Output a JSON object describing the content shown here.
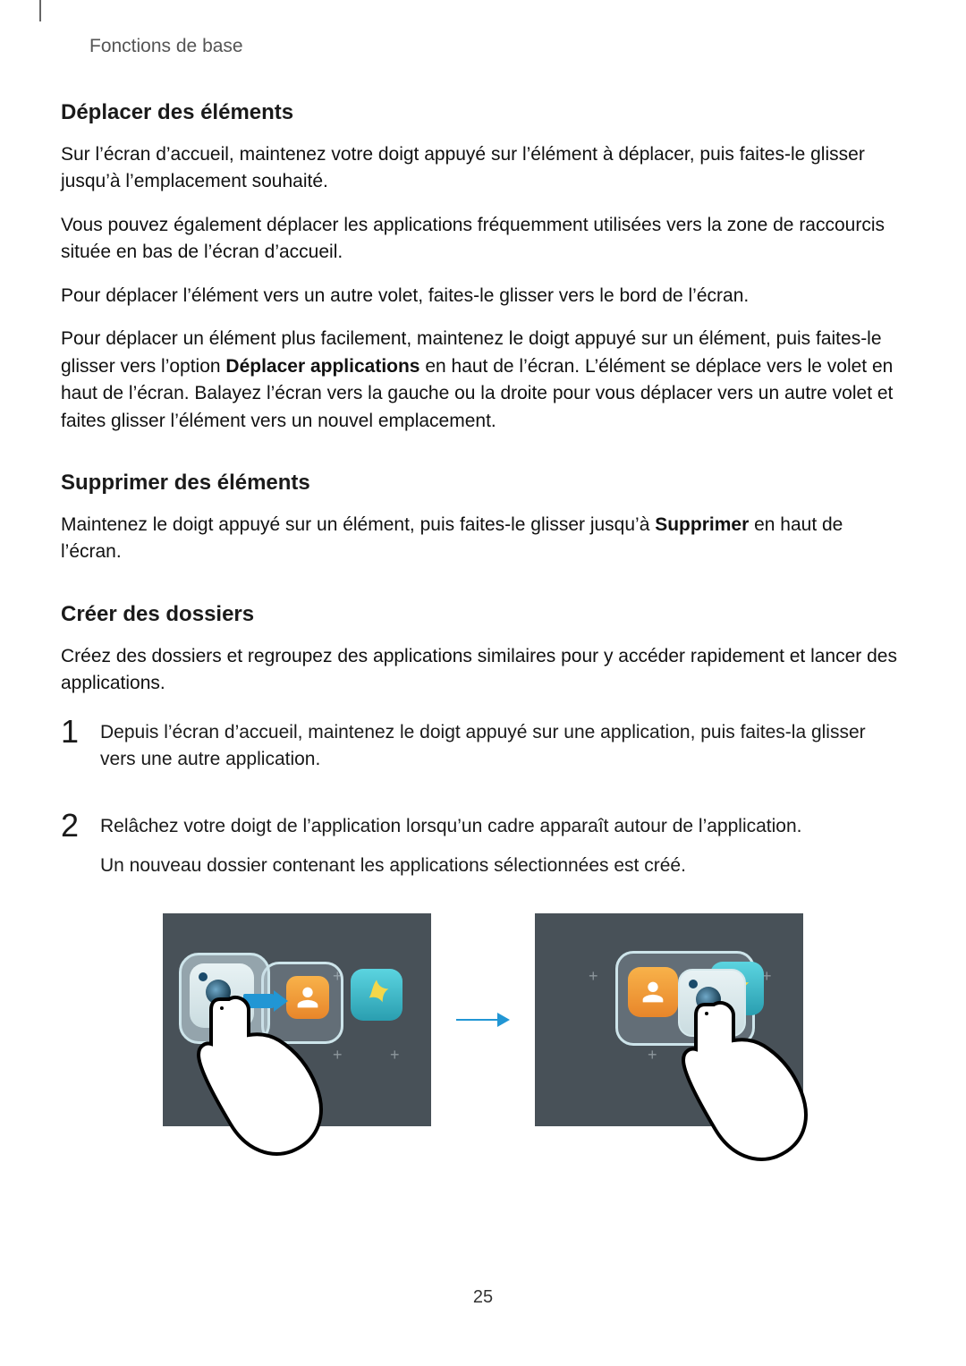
{
  "header": "Fonctions de base",
  "sections": {
    "move": {
      "heading": "Déplacer des éléments",
      "p1": "Sur l’écran d’accueil, maintenez votre doigt appuyé sur l’élément à déplacer, puis faites-le glisser jusqu’à l’emplacement souhaité.",
      "p2": "Vous pouvez également déplacer les applications fréquemment utilisées vers la zone de raccourcis située en bas de l’écran d’accueil.",
      "p3": "Pour déplacer l’élément vers un autre volet, faites-le glisser vers le bord de l’écran.",
      "p4a": "Pour déplacer un élément plus facilement, maintenez le doigt appuyé sur un élément, puis faites-le glisser vers l’option ",
      "p4b": "Déplacer applications",
      "p4c": " en haut de l’écran. L’élément se déplace vers le volet en haut de l’écran. Balayez l’écran vers la gauche ou la droite pour vous déplacer vers un autre volet et faites glisser l’élément vers un nouvel emplacement."
    },
    "delete": {
      "heading": "Supprimer des éléments",
      "p1a": "Maintenez le doigt appuyé sur un élément, puis faites-le glisser jusqu’à ",
      "p1b": "Supprimer",
      "p1c": " en haut de l’écran."
    },
    "folders": {
      "heading": "Créer des dossiers",
      "intro": "Créez des dossiers et regroupez des applications similaires pour y accéder rapidement et lancer des applications.",
      "step1_num": "1",
      "step1": "Depuis l’écran d’accueil, maintenez le doigt appuyé sur une application, puis faites-la glisser vers une autre application.",
      "step2_num": "2",
      "step2a": "Relâchez votre doigt de l’application lorsqu’un cadre apparaît autour de l’application.",
      "step2b": "Un nouveau dossier contenant les applications sélectionnées est créé."
    }
  },
  "page_number": "25"
}
